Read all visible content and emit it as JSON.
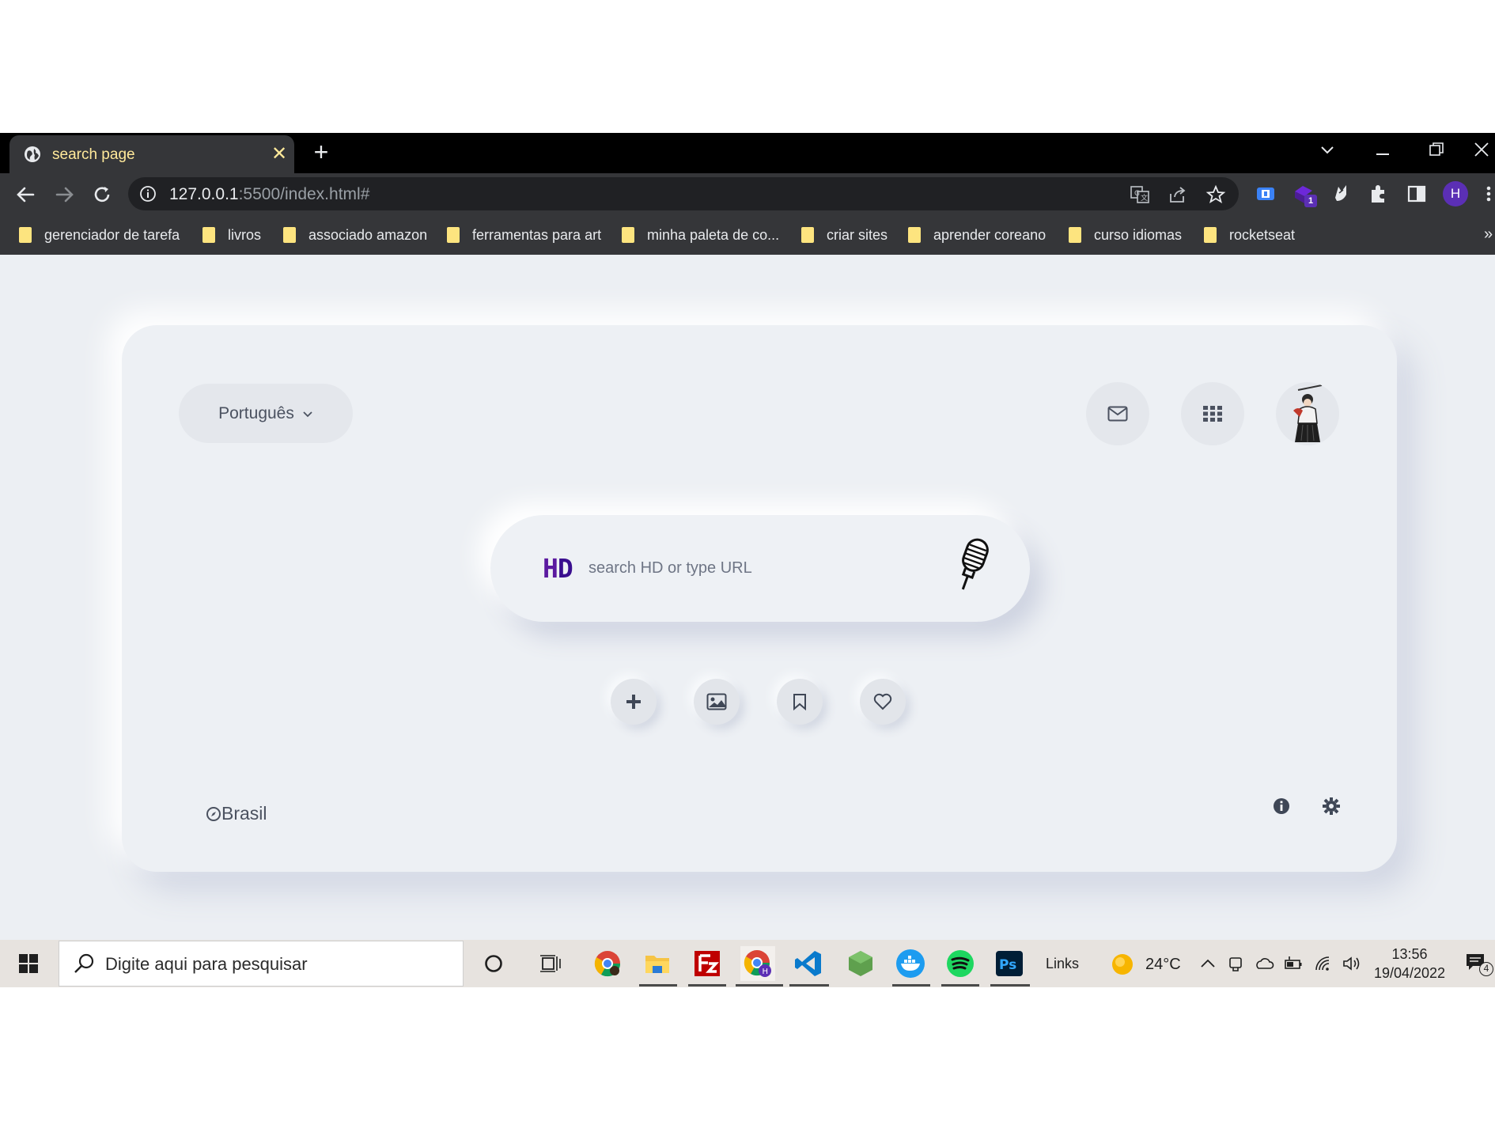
{
  "browser": {
    "tab_title": "search page",
    "url_host": "127.0.0.1",
    "url_rest": ":5500/index.html#",
    "profile_initial": "H",
    "extension_badge": "1"
  },
  "bookmarks": [
    {
      "label": "gerenciador de tarefa"
    },
    {
      "label": "livros"
    },
    {
      "label": "associado amazon"
    },
    {
      "label": "ferramentas para art"
    },
    {
      "label": "minha paleta de co..."
    },
    {
      "label": "criar sites"
    },
    {
      "label": "aprender coreano"
    },
    {
      "label": "curso idiomas"
    },
    {
      "label": "rocketseat"
    }
  ],
  "bookmarks_more": "»",
  "page": {
    "language": "Português",
    "search_logo_h": "H",
    "search_logo_d": "D",
    "search_placeholder": "search HD or type URL",
    "region": "Brasil"
  },
  "taskbar": {
    "search_placeholder": "Digite aqui para pesquisar",
    "links_label": "Links",
    "temperature": "24°C",
    "time": "13:56",
    "date": "19/04/2022",
    "notification_count": "4"
  },
  "colors": {
    "tab_text": "#ffe99a",
    "page_bg": "#eceff3",
    "logo_purple": "#5b1aa0",
    "profile_purple": "#5b2fb5"
  }
}
